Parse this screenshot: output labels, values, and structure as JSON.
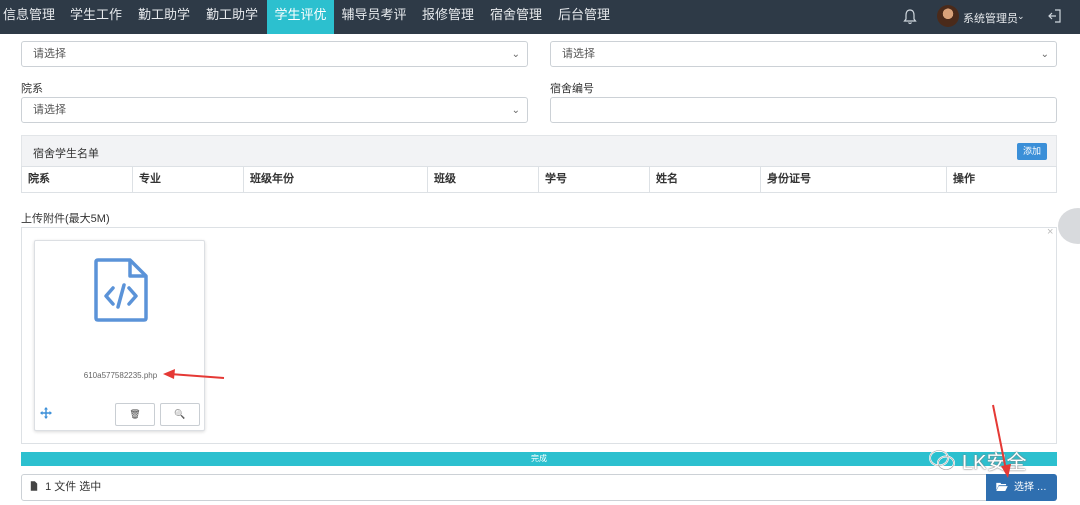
{
  "nav": {
    "items": [
      {
        "label": "信息管理",
        "active": false
      },
      {
        "label": "学生工作",
        "active": false
      },
      {
        "label": "勤工助学",
        "active": false
      },
      {
        "label": "勤工助学",
        "active": false
      },
      {
        "label": "学生评优",
        "active": true
      },
      {
        "label": "辅导员考评",
        "active": false
      },
      {
        "label": "报修管理",
        "active": false
      },
      {
        "label": "宿舍管理",
        "active": false
      },
      {
        "label": "后台管理",
        "active": false
      }
    ],
    "user_name": "系统管理员",
    "caret": "⌄"
  },
  "form": {
    "select_top_left": "请选择",
    "select_top_right": "请选择",
    "dept_label": "院系",
    "dept_value": "请选择",
    "dorm_no_label": "宿舍编号",
    "dorm_no_value": "",
    "select_chevron": "⌄"
  },
  "student_list": {
    "title": "宿舍学生名单",
    "add_label": "添加",
    "columns": [
      "院系",
      "专业",
      "班级年份",
      "班级",
      "学号",
      "姓名",
      "身份证号",
      "操作"
    ]
  },
  "upload": {
    "label": "上传附件(最大5M)",
    "file_name": "610a577582235.php",
    "close_glyph": "×",
    "delete_glyph": "🗑",
    "zoom_glyph": "🔍",
    "progress_label": "完成",
    "caption": "1 文件 选中",
    "browse_label": "选择 …"
  },
  "watermark": "LK安全",
  "colors": {
    "nav_bg": "#2e3a47",
    "accent": "#2cc0cf",
    "primary": "#2f6fb0",
    "arrow_red": "#e53935"
  }
}
